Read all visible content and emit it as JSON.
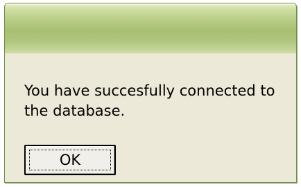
{
  "dialog": {
    "title": "",
    "message": "You have succesfully connected to the database.",
    "ok_label": "OK"
  },
  "colors": {
    "titlebar": "#afc47c",
    "body": "#ece9d8",
    "border": "#6f8f4f"
  }
}
